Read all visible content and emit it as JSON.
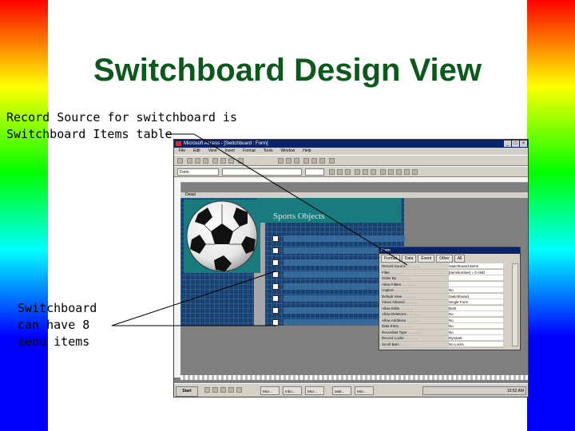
{
  "slide": {
    "title": "Switchboard Design View",
    "callout_top": "Record Source for switchboard is\nSwitchboard Items table",
    "callout_bottom": "Switchboard\ncan have 8\nmenu items"
  },
  "window": {
    "title": "Microsoft Access - [Switchboard : Form]",
    "menu": [
      "File",
      "Edit",
      "View",
      "Insert",
      "Format",
      "Tools",
      "Window",
      "Help"
    ],
    "object_combo": "Form",
    "section_bar": "Detail",
    "form_caption": "Sports Objects"
  },
  "property_sheet": {
    "title": "Form",
    "tabs": [
      "Format",
      "Data",
      "Event",
      "Other",
      "All"
    ],
    "rows": [
      {
        "name": "Record Source",
        "value": "Switchboard Items"
      },
      {
        "name": "Filter",
        "value": "[ItemNumber] = 0 AND"
      },
      {
        "name": "Order By",
        "value": ""
      },
      {
        "name": "Allow Filters",
        "value": ""
      },
      {
        "name": "Caption",
        "value": "No"
      },
      {
        "name": "Default View",
        "value": "Switchboard"
      },
      {
        "name": "Views Allowed",
        "value": "Single Form"
      },
      {
        "name": "Allow Edits",
        "value": "Both"
      },
      {
        "name": "Allow Deletions",
        "value": "No"
      },
      {
        "name": "Allow Additions",
        "value": "No"
      },
      {
        "name": "Data Entry",
        "value": "No"
      },
      {
        "name": "Recordset Type",
        "value": "No"
      },
      {
        "name": "Record Locks",
        "value": "Dynaset"
      },
      {
        "name": "Scroll Bars",
        "value": "No Locks"
      }
    ]
  },
  "taskbar": {
    "start_label": "Start",
    "tasks": [
      "Micr...",
      "Inbo...",
      "Micr...",
      "Swit...",
      "Micr..."
    ],
    "clock": "10:52 AM"
  },
  "colors": {
    "title": "#0b5a1c",
    "form_background": "#1e3f6e",
    "form_header": "#1a7b7e"
  }
}
